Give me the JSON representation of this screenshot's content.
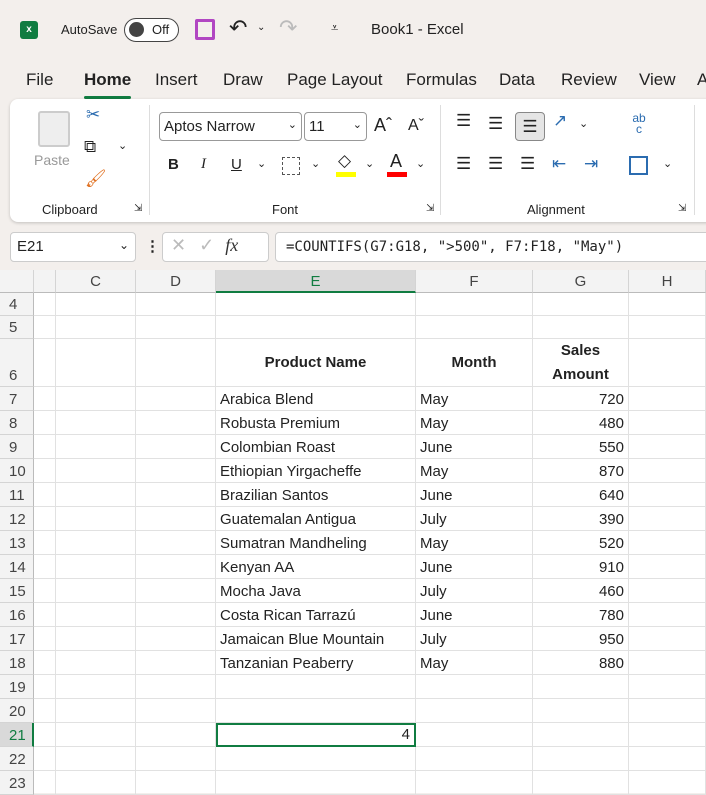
{
  "titlebar": {
    "autosave": "AutoSave",
    "toggle": "Off",
    "title": "Book1  -  Excel"
  },
  "tabs": [
    "File",
    "Home",
    "Insert",
    "Draw",
    "Page Layout",
    "Formulas",
    "Data",
    "Review",
    "View",
    "A"
  ],
  "ribbon": {
    "paste": "Paste",
    "font_name": "Aptos Narrow",
    "font_size": "11",
    "groups": {
      "clipboard": "Clipboard",
      "font": "Font",
      "alignment": "Alignment"
    },
    "bold": "B",
    "italic": "I",
    "underline": "U",
    "font_color": "A",
    "grow": "Aˆ",
    "shrink": "Aˇ",
    "wrap": "ab c"
  },
  "formula_bar": {
    "name_box": "E21",
    "fx": "fx",
    "formula": "=COUNTIFS(G7:G18, \">500\", F7:F18, \"May\")"
  },
  "columns": [
    "C",
    "D",
    "E",
    "F",
    "G",
    "H"
  ],
  "rows": [
    "4",
    "5",
    "6",
    "7",
    "8",
    "9",
    "10",
    "11",
    "12",
    "13",
    "14",
    "15",
    "16",
    "17",
    "18",
    "19",
    "20",
    "21",
    "22",
    "23"
  ],
  "table": {
    "headers": [
      "Product Name",
      "Month",
      "Sales Amount"
    ],
    "data": [
      [
        "Arabica Blend",
        "May",
        "720"
      ],
      [
        "Robusta Premium",
        "May",
        "480"
      ],
      [
        "Colombian Roast",
        "June",
        "550"
      ],
      [
        "Ethiopian Yirgacheffe",
        "May",
        "870"
      ],
      [
        "Brazilian Santos",
        "June",
        "640"
      ],
      [
        "Guatemalan Antigua",
        "July",
        "390"
      ],
      [
        "Sumatran Mandheling",
        "May",
        "520"
      ],
      [
        "Kenyan AA",
        "June",
        "910"
      ],
      [
        "Mocha Java",
        "July",
        "460"
      ],
      [
        "Costa Rican Tarrazú",
        "June",
        "780"
      ],
      [
        "Jamaican Blue Mountain",
        "July",
        "950"
      ],
      [
        "Tanzanian Peaberry",
        "May",
        "880"
      ]
    ]
  },
  "result": {
    "cell": "E21",
    "value": "4"
  },
  "colors": {
    "accent": "#107c41",
    "fill_highlight": "#ffff00",
    "font_color": "#ff0000"
  }
}
